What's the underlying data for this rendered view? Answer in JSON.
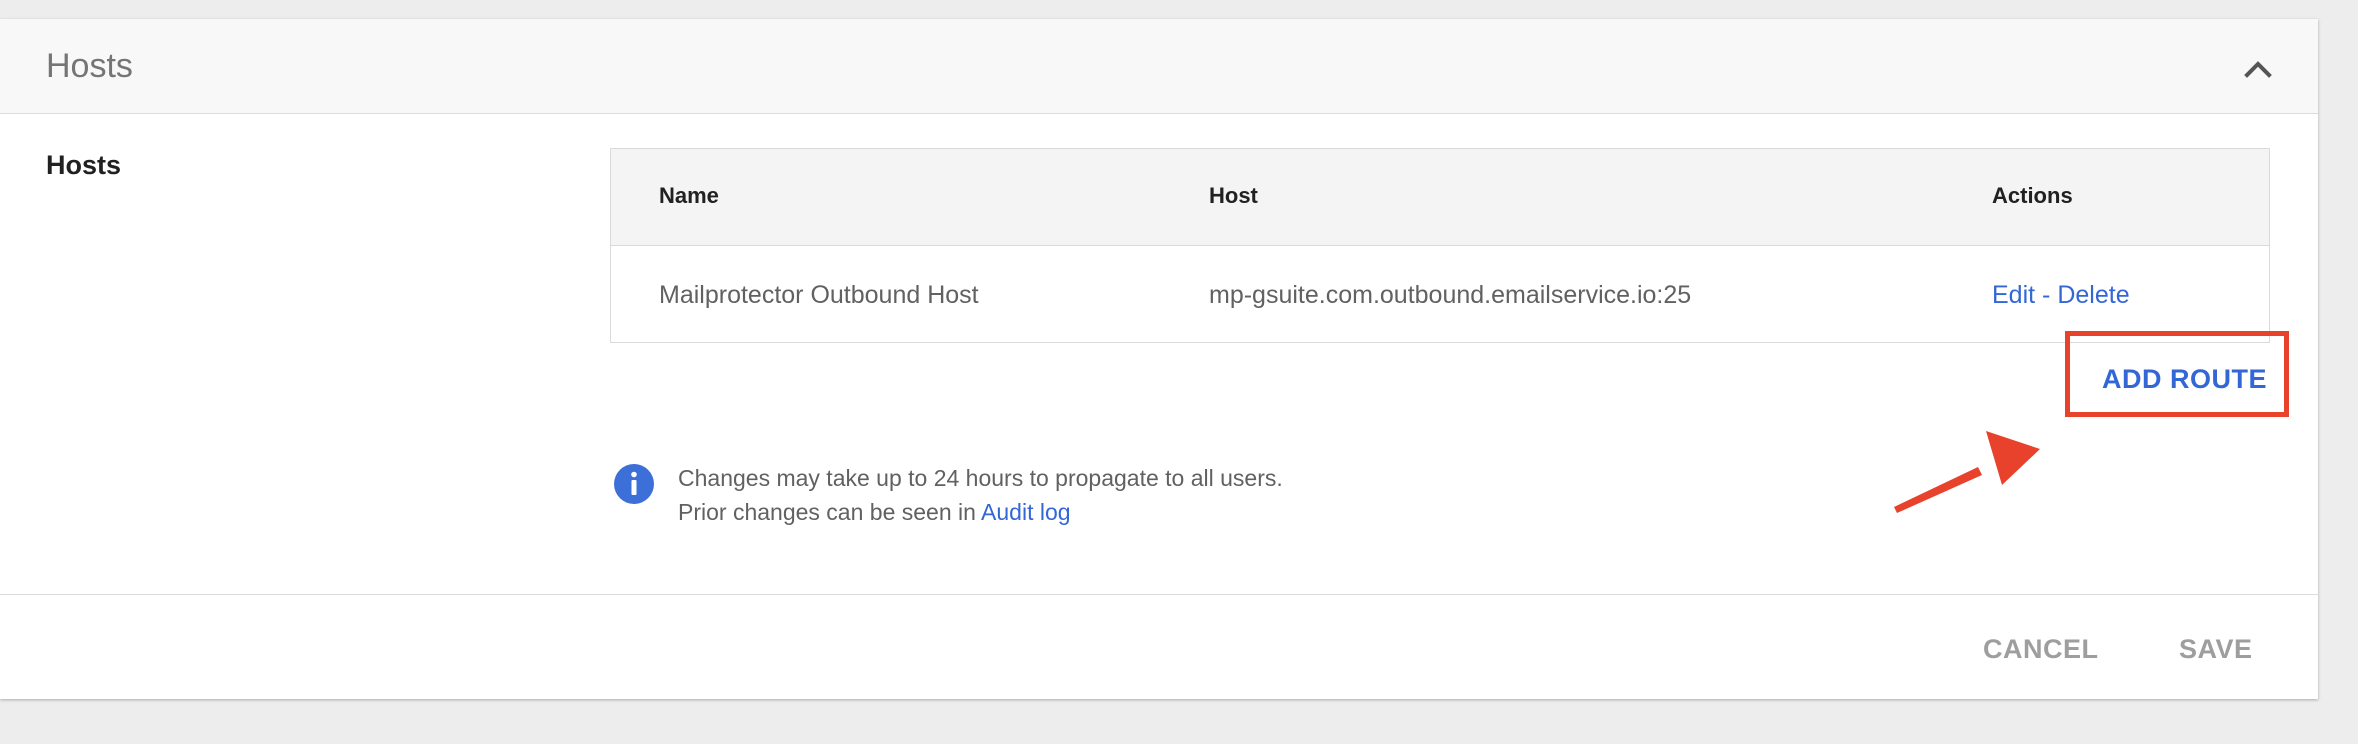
{
  "header": {
    "title": "Hosts",
    "collapse_icon": "chevron-up-icon"
  },
  "section": {
    "label": "Hosts"
  },
  "table": {
    "columns": [
      "Name",
      "Host",
      "Actions"
    ],
    "rows": [
      {
        "name": "Mailprotector Outbound Host",
        "host": "mp-gsuite.com.outbound.emailservice.io:25",
        "edit_label": "Edit",
        "separator": "-",
        "delete_label": "Delete"
      }
    ]
  },
  "add_route": {
    "label": "ADD ROUTE",
    "highlight_color": "#e8412c"
  },
  "annotation": {
    "arrow_icon": "red-arrow-icon",
    "color": "#e8412c"
  },
  "info": {
    "icon": "info-icon",
    "line1": "Changes may take up to 24 hours to propagate to all users.",
    "line2_prefix": "Prior changes can be seen in",
    "audit_link_label": "Audit log"
  },
  "footer": {
    "cancel_label": "CANCEL",
    "save_label": "SAVE"
  },
  "colors": {
    "accent": "#3367d6",
    "muted_button": "#9e9e9e"
  }
}
